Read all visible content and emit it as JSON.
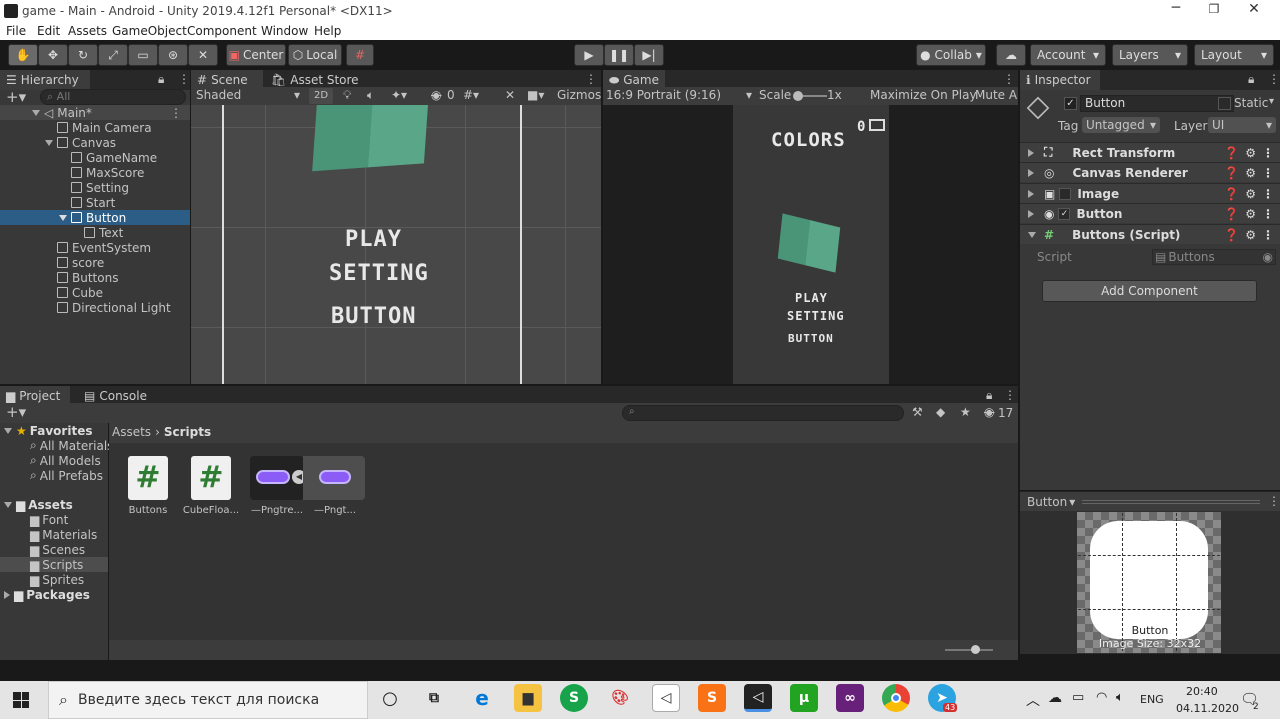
{
  "window": {
    "title": "game - Main - Android - Unity 2019.4.12f1 Personal* <DX11>"
  },
  "menu": [
    "File",
    "Edit",
    "Assets",
    "GameObject",
    "Component",
    "Window",
    "Help"
  ],
  "toolbar": {
    "center": "Center",
    "local": "Local",
    "collab": "Collab",
    "account": "Account",
    "layers": "Layers",
    "layout": "Layout"
  },
  "hierarchy": {
    "tab": "Hierarchy",
    "search_placeholder": "All",
    "items": [
      "Main*",
      "Main Camera",
      "Canvas",
      "GameName",
      "MaxScore",
      "Setting",
      "Start",
      "Button",
      "Text",
      "EventSystem",
      "score",
      "Buttons",
      "Cube",
      "Directional Light"
    ]
  },
  "scene": {
    "tab": "Scene",
    "tab2": "Asset Store",
    "shading": "Shaded",
    "mode2d": "2D",
    "gizmos": "Gizmos",
    "hidden_count": "0",
    "texts": [
      "PLAY",
      "SETTING",
      "BUTTON"
    ]
  },
  "game": {
    "tab": "Game",
    "aspect": "16:9 Portrait (9:16)",
    "scale_label": "Scale",
    "scale_value": "1x",
    "maximize": "Maximize On Play",
    "mute": "Mute Au",
    "title": "COLORS",
    "score": "0",
    "texts": [
      "PLAY",
      "SETTING",
      "BUTTON"
    ]
  },
  "inspector": {
    "tab": "Inspector",
    "object_name": "Button",
    "static_label": "Static",
    "tag_label": "Tag",
    "tag_value": "Untagged",
    "layer_label": "Layer",
    "layer_value": "UI",
    "components": [
      "Rect Transform",
      "Canvas Renderer",
      "Image",
      "Button",
      "Buttons (Script)"
    ],
    "script_label": "Script",
    "script_value": "Buttons",
    "add_component": "Add Component",
    "preview_label": "Button",
    "preview_name": "Button",
    "preview_size": "Image Size: 32x32"
  },
  "project": {
    "tab": "Project",
    "tab2": "Console",
    "hidden_count": "17",
    "breadcrumb_root": "Assets",
    "breadcrumb_current": "Scripts",
    "favorites": "Favorites",
    "fav_items": [
      "All Materials",
      "All Models",
      "All Prefabs"
    ],
    "assets_label": "Assets",
    "asset_folders": [
      "Font",
      "Materials",
      "Scenes",
      "Scripts",
      "Sprites"
    ],
    "packages": "Packages",
    "files": [
      "Buttons",
      "CubeFloa...",
      "—Pngtre...",
      "—Pngt..."
    ]
  },
  "taskbar": {
    "search_placeholder": "Введите здесь текст для поиска",
    "lang": "ENG",
    "time": "20:40",
    "date": "04.11.2020",
    "notif_count": "2",
    "telegram_badge": "43"
  },
  "colors": {
    "accent": "#2c5d87",
    "selected": "#2c5d87",
    "cube": "#4a9478"
  }
}
